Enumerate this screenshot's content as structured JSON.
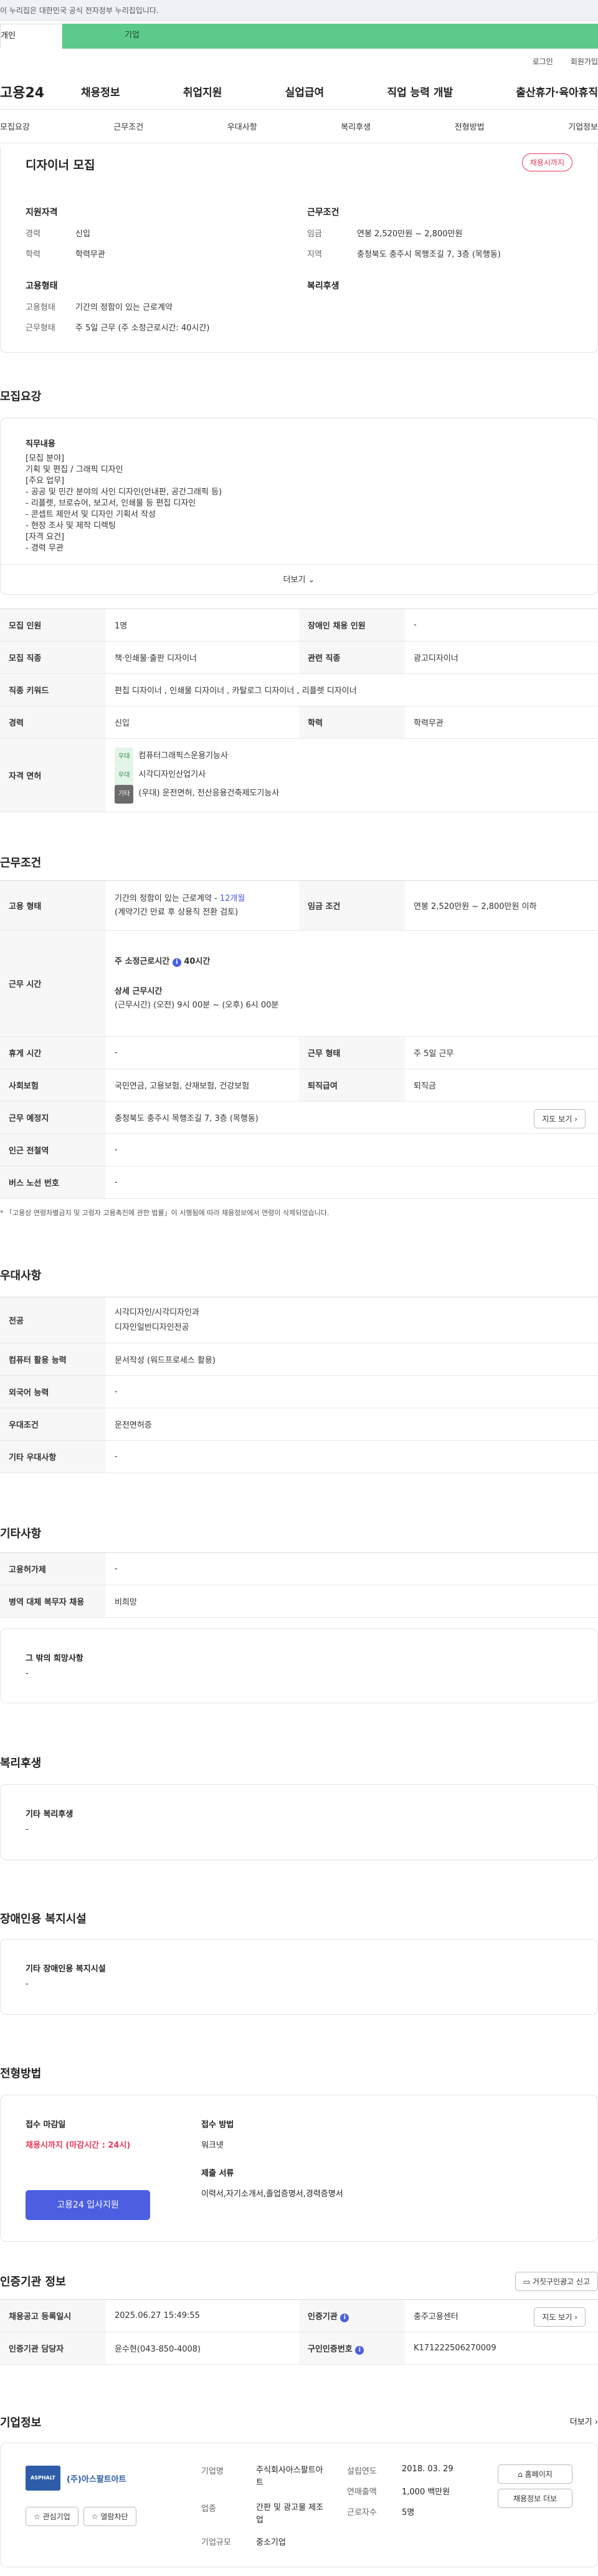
{
  "gov_banner": "이 누리집은 대한민국 공식 전자정부 누리집입니다.",
  "top_tabs": {
    "individual": "개인",
    "business": "기업"
  },
  "util": {
    "login": "로그인",
    "signup": "회원가입"
  },
  "logo": "고용24",
  "gnb": [
    "채용정보",
    "취업지원",
    "실업급여",
    "직업 능력 개발",
    "출산휴가·육아휴직"
  ],
  "subnav": [
    "모집요강",
    "근무조건",
    "우대사항",
    "복리후생",
    "전형방법",
    "기업정보"
  ],
  "summary": {
    "title": "디자이너 모집",
    "status": "채용시까지",
    "qual_title": "지원자격",
    "career_label": "경력",
    "career_value": "신입",
    "edu_label": "학력",
    "edu_value": "학력무관",
    "cond_title": "근무조건",
    "wage_label": "임금",
    "wage_value": "연봉 2,520만원 ~ 2,800만원",
    "region_label": "지역",
    "region_value": "충청북도 충주시 목행조길 7, 3층 (목행동)",
    "emp_title": "고용형태",
    "emptype_label": "고용형태",
    "emptype_value": "기간의 정함이 있는 근로계약",
    "worktype_label": "근무형태",
    "worktype_value": "주 5일 근무 (주 소정근로시간: 40시간)",
    "welfare_title": "복리후생"
  },
  "recruit": {
    "section_title": "모집요강",
    "duty_title": "직무내용",
    "duty_lines": [
      "[모집 분야]",
      "기획 및 편집 / 그래픽 디자인",
      "[주요 업무]",
      "- 공공 및 민간 분야의 사인 디자인(안내판, 공간그래픽 등)",
      "- 리플렛, 브로슈어, 보고서, 인쇄물 등 편집 디자인",
      "- 콘셉트 제안서 및 디자인 기획서 작성",
      "- 현장 조사 및 제작 디렉팅",
      "[자격 요건]",
      "- 경력 무관"
    ],
    "more_label": "더보기",
    "rows": {
      "headcount_label": "모집 인원",
      "headcount_value": "1명",
      "disabled_label": "장애인 채용 인원",
      "disabled_value": "-",
      "job_label": "모집 직종",
      "job_value": "책·인쇄물·출판 디자이너",
      "related_label": "관련 직종",
      "related_value": "광고디자이너",
      "kw_label": "직종 키워드",
      "kw_value": "편집 디자이너 , 인쇄물 디자이너 , 카탈로그 디자이너 , 리플렛 디자이너",
      "career_label": "경력",
      "career_value": "신입",
      "edu_label": "학력",
      "edu_value": "학력무관",
      "license_label": "자격 면허",
      "licenses": [
        {
          "badge": "우대",
          "name": "컴퓨터그래픽스운용기능사"
        },
        {
          "badge": "우대",
          "name": "시각디자인산업기사"
        },
        {
          "badge": "기타",
          "name": "(우대) 운전면허, 전산응용건축제도기능사"
        }
      ]
    }
  },
  "work": {
    "section_title": "근무조건",
    "type_label": "고용 형태",
    "type_value_1": "기간의 정함이 있는 근로계약 - ",
    "type_value_months": "12개월",
    "type_value_2": "(계약기간 만료 후 상용직 전환 검토)",
    "wage_label": "임금 조건",
    "wage_value": "연봉 2,520만원 ~ 2,800만원 이하",
    "time_label": "근무 시간",
    "weekly_label": "주 소정근로시간",
    "weekly_value": "40시간",
    "detail_label": "상세 근무시간",
    "detail_value": "(근무시간) (오전) 9시 00분 ~ (오후) 6시 00분",
    "rest_label": "휴게 시간",
    "rest_value": "-",
    "shape_label": "근무 형태",
    "shape_value": "주 5일 근무",
    "ins_label": "사회보험",
    "ins_value": "국민연금, 고용보험, 산재보험, 건강보험",
    "retire_label": "퇴직급여",
    "retire_value": "퇴직금",
    "place_label": "근무 예정지",
    "place_value": "충청북도 충주시 목행조길 7, 3층 (목행동)",
    "map_btn": "지도 보기",
    "station_label": "인근 전철역",
    "station_value": "-",
    "bus_label": "버스 노선 번호",
    "bus_value": "-",
    "note": "* 「고용상 연령차별금지 및 고령자 고용촉진에 관한 법률」이 시행됨에 따라 채용정보에서 연령이 삭제되었습니다."
  },
  "pref": {
    "section_title": "우대사항",
    "major_label": "전공",
    "major_value_1": "시각디자인/시각디자인과",
    "major_value_2": "디자인일반디자인전공",
    "pc_label": "컴퓨터 활용 능력",
    "pc_value": "문서작성 (워드프로세스 활용)",
    "lang_label": "외국어 능력",
    "lang_value": "-",
    "cond_label": "우대조건",
    "cond_value": "운전면허증",
    "etc_label": "기타 우대사항",
    "etc_value": "-"
  },
  "other": {
    "section_title": "기타사항",
    "insured_label": "고용허가제",
    "insured_value": "-",
    "military_label": "병역 대체 복무자 채용",
    "military_value": "비희망",
    "wish_title": "그 밖의 희망사항",
    "wish_value": "-"
  },
  "welfare": {
    "section_title": "복리후생",
    "sub": "기타 복리후생",
    "value": "-"
  },
  "disabled": {
    "section_title": "장애인용 복지시설",
    "sub": "기타 장애인용 복지시설",
    "value": "-"
  },
  "selection": {
    "section_title": "전형방법",
    "deadline_label": "접수 마감일",
    "deadline_value": "채용시까지 (마감시간 : 24시)",
    "apply_btn": "고용24 입사지원",
    "method_label": "접수 방법",
    "method_value": "워크넷",
    "docs_label": "제출 서류",
    "docs_value": "이력서,자기소개서,졸업증명서,경력증명서"
  },
  "cert": {
    "section_title": "인증기관 정보",
    "report_btn": "거짓구인광고 신고",
    "reg_label": "채용공고 등록일시",
    "reg_value": "2025.06.27 15:49:55",
    "agency_label": "인증기관",
    "agency_value": "충주고용센터",
    "map_btn": "지도 보기",
    "manager_label": "인증기관 담당자",
    "manager_value": "윤수현(043-850-4008)",
    "id_label": "구인인증번호",
    "id_value": "K171222506270009"
  },
  "company": {
    "section_title": "기업정보",
    "more": "더보기",
    "logo_text": "ASPHALT ART",
    "name": "(주)아스팔트아트",
    "fav_btn": "관심기업",
    "review_btn": "열람차단",
    "name_label": "기업명",
    "name_value": "주식회사아스팔트아트",
    "biz_label": "업종",
    "biz_value": "간판 및 광고물 제조업",
    "size_label": "기업규모",
    "size_value": "중소기업",
    "found_label": "설립연도",
    "found_value": "2018. 03. 29",
    "sales_label": "연매출액",
    "sales_value": "1,000 백만원",
    "emp_label": "근로자수",
    "emp_value": "5명",
    "home_btn": "홈페이지",
    "jobs_btn": "채용정보 더보"
  },
  "colors": {
    "accent_blue": "#4b5fe0",
    "accent_red": "#e53b5b",
    "green_tab": "#5ccb8a"
  }
}
